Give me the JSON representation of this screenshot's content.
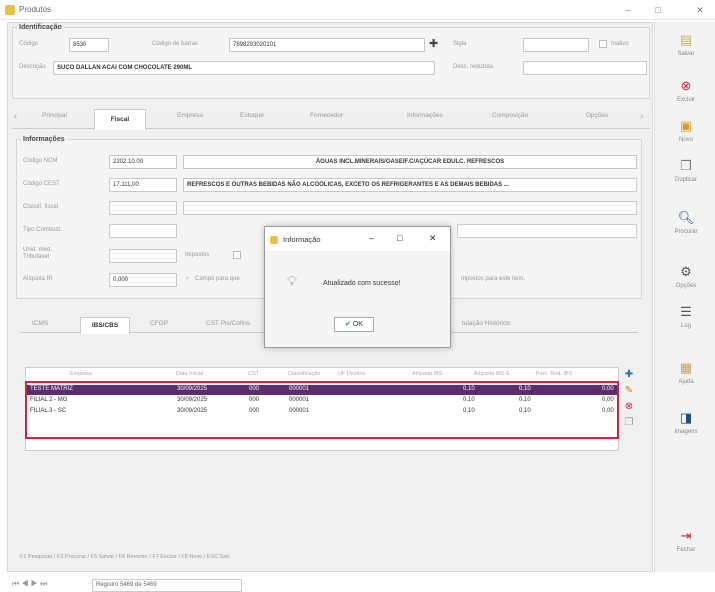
{
  "window": {
    "title": "Produtos",
    "min": "–",
    "max": "□",
    "close": "✕"
  },
  "identificacao": {
    "group_label": "Identificação",
    "codigo_label": "Código",
    "codigo": "8530",
    "barras_label": "Código de barras",
    "barras": "7898293020101",
    "sigla_label": "Sigla",
    "inativo_label": "Inativo",
    "descricao_label": "Descrição",
    "descricao": "SUCO DALLAN ACAI COM CHOCOLATE 290ML",
    "desc_reduzida_label": "Desc. reduzida"
  },
  "tabs": [
    "Principal",
    "Fiscal",
    "Empresa",
    "Estoque",
    "Fornecedor",
    "Informações",
    "Composição",
    "Opções"
  ],
  "info": {
    "group_label": "Informações",
    "ncm_label": "Código NCM",
    "ncm": "2202.10.00",
    "ncm_desc": "ÁGUAS INCL.MINERAIS/GASEIF.C/AÇÚCAR EDULC. REFRESCOS",
    "cest_label": "Código CEST",
    "cest": "17.111.00",
    "cest_desc": "REFRESCOS E OUTRAS BEBIDAS NÃO ALCOÓLICAS, EXCETO OS REFRIGERANTES E AS DEMAIS BEBIDAS ...",
    "classif_label": "Classif. fiscal",
    "combust_label": "Tipo Combust.",
    "unid_label": "Unid. med. Tributável",
    "impostos_label": "Impostos",
    "aliquota_label": "Alíquota IR",
    "aliquota": "0,000",
    "campo_hint": "Campo para que",
    "impostos_hint": "mpostos para este item."
  },
  "subtabs": [
    "ICMS",
    "IBS/CBS",
    "CFOP",
    "CST Pis/Cofins",
    "tulação Histórico"
  ],
  "grid": {
    "headers": [
      "Empresa",
      "Data Inicial",
      "CST",
      "Classificação",
      "UF Destino",
      "Alíquota IBS",
      "Alíquota IBS E",
      "Perc. Red. IBS"
    ],
    "rows": [
      {
        "empresa": "TESTE MATRIZ",
        "data": "30/09/2025",
        "cst": "000",
        "class": "000001",
        "a1": "0,10",
        "a2": "0,10",
        "p": "0,00"
      },
      {
        "empresa": "FILIAL 2 - MG",
        "data": "30/09/2025",
        "cst": "000",
        "class": "000001",
        "a1": "0,10",
        "a2": "0,10",
        "p": "0,00"
      },
      {
        "empresa": "FILIAL 3 - SC",
        "data": "30/09/2025",
        "cst": "000",
        "class": "000001",
        "a1": "0,10",
        "a2": "0,10",
        "p": "0,00"
      }
    ]
  },
  "dialog": {
    "title": "Informação",
    "message": "Atualizado com sucesso!",
    "ok": "OK"
  },
  "sidebar": [
    "Salvar",
    "Excluir",
    "Novo",
    "Duplicar",
    "Procurar",
    "Opções",
    "Log",
    "Ajuda",
    "Imagens",
    "Fechar"
  ],
  "status": {
    "shortcuts": "F1 Pesquisar / F2 Procurar / F5 Salvar / F6 Reverter / F7 Excluir / F8 Novo / ESC Sair",
    "registro": "Registro 5469 de 5469"
  }
}
